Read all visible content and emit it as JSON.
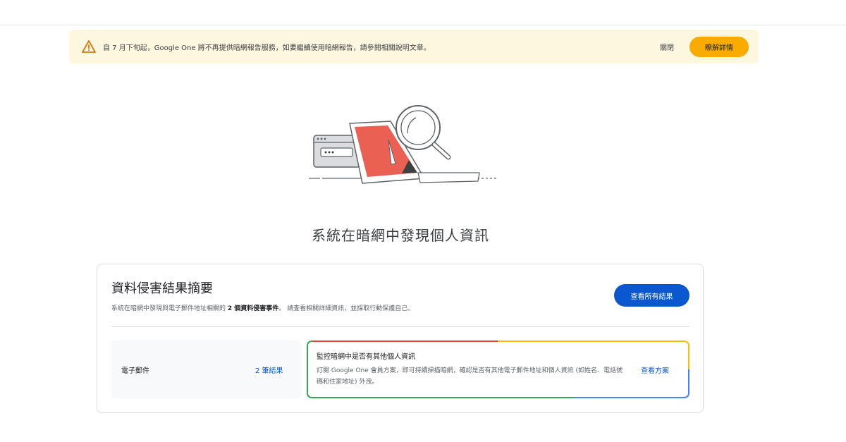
{
  "banner": {
    "message": "自 7 月下旬起，Google One 將不再提供暗網報告服務，如要繼續使用暗網報告，請參閱相關說明文章。",
    "close_label": "關閉",
    "learn_more_label": "瞭解詳情",
    "icon": "warning-icon",
    "accent_color": "#f9ab00"
  },
  "headline": "系統在暗網中發現個人資訊",
  "summary": {
    "title": "資料侵害結果摘要",
    "subtitle_before": "系統在暗網中發現與電子郵件地址相關的",
    "subtitle_bold": "2 個資料侵害事件",
    "subtitle_after": "。 請查看相關詳細資訊，並採取行動保護自己。",
    "view_all_label": "查看所有結果",
    "primary_color": "#0b57d0"
  },
  "email_row": {
    "label": "電子郵件",
    "count": "2 筆結果"
  },
  "monitor": {
    "title": "監控暗網中是否有其他個人資訊",
    "description": "訂閱 Google One 會員方案，即可持續掃描暗網，確認是否有其他電子郵件地址和個人資訊 (如姓名、電話號碼和住家地址) 外洩。",
    "link_label": "查看方案"
  }
}
